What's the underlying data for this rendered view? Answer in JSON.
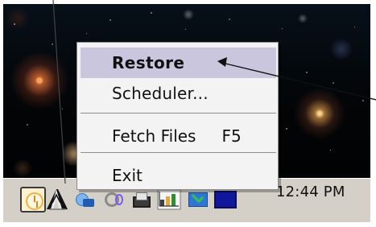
{
  "context_menu": {
    "items": [
      {
        "label": "Restore",
        "selected": true
      },
      {
        "label": "Scheduler...",
        "selected": false
      },
      {
        "label": "Fetch Files",
        "shortcut": "F5",
        "selected": false
      },
      {
        "label": "Exit",
        "selected": false
      }
    ]
  },
  "tray": {
    "time": "12:44 PM"
  },
  "icons": {
    "tray": [
      "clock-icon",
      "app-icon",
      "network-icon",
      "volume-icon",
      "printer-icon",
      "chart-icon",
      "mail-icon",
      "window-icon"
    ]
  },
  "colors": {
    "menu_highlight": "#c9c6de",
    "taskbar": "#d4d0c8",
    "window_icon_blue": "#11179c"
  }
}
